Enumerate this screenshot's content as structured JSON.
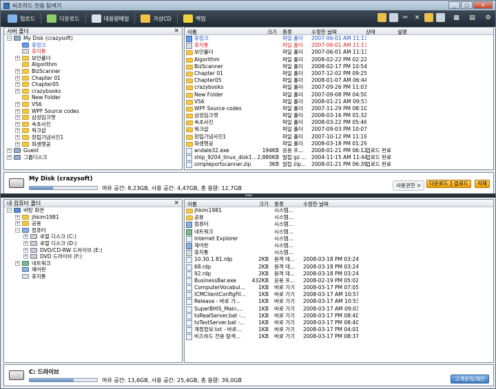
{
  "window": {
    "title": "비즈하드 전용 탐색기"
  },
  "toolbar": {
    "buttons": [
      {
        "label": "업로드",
        "color": "#7fb5ea"
      },
      {
        "label": "다운로드",
        "color": "#8fd06a"
      },
      {
        "label": "대용량메일",
        "color": "#d9e2ea"
      },
      {
        "label": "가상CD",
        "color": "#f3c24a"
      },
      {
        "label": "백업",
        "color": "#f2d23c"
      }
    ],
    "right_icons": [
      "new-folder-icon",
      "copy-icon",
      "cut-icon",
      "delete-icon",
      "paste-icon",
      "properties-icon",
      "view-icon",
      "layout-icon",
      "settings-icon"
    ]
  },
  "server": {
    "title": "서버 폴더",
    "close": "×",
    "tree": [
      {
        "label": "My Disk (crazysoft)",
        "level": 0,
        "toggle": "−",
        "color": "#000",
        "kind": "disk"
      },
      {
        "label": "휴링크",
        "level": 1,
        "toggle": "",
        "color": "#1f4fd1",
        "kind": "special"
      },
      {
        "label": "휴지통",
        "level": 1,
        "toggle": "",
        "color": "#d62020",
        "kind": "trash"
      },
      {
        "label": "보안폴더",
        "level": 1,
        "toggle": "+",
        "color": "#000",
        "kind": "folder"
      },
      {
        "label": "Algorithm",
        "level": 1,
        "toggle": "",
        "color": "#000",
        "kind": "folder"
      },
      {
        "label": "BizScanner",
        "level": 1,
        "toggle": "+",
        "color": "#000",
        "kind": "folder"
      },
      {
        "label": "Chapter 01",
        "level": 1,
        "toggle": "+",
        "color": "#000",
        "kind": "folder"
      },
      {
        "label": "Chapter05",
        "level": 1,
        "toggle": "+",
        "color": "#000",
        "kind": "folder"
      },
      {
        "label": "crazybooks",
        "level": 1,
        "toggle": "+",
        "color": "#000",
        "kind": "folder"
      },
      {
        "label": "New Folder",
        "level": 1,
        "toggle": "",
        "color": "#000",
        "kind": "folder"
      },
      {
        "label": "VS6",
        "level": 1,
        "toggle": "+",
        "color": "#000",
        "kind": "folder"
      },
      {
        "label": "WPF Source codes",
        "level": 1,
        "toggle": "+",
        "color": "#000",
        "kind": "folder"
      },
      {
        "label": "삼성임크젯",
        "level": 1,
        "toggle": "+",
        "color": "#000",
        "kind": "folder"
      },
      {
        "label": "속초사진",
        "level": 1,
        "toggle": "+",
        "color": "#000",
        "kind": "folder"
      },
      {
        "label": "워크샵",
        "level": 1,
        "toggle": "+",
        "color": "#000",
        "kind": "folder"
      },
      {
        "label": "창립기념사진1",
        "level": 1,
        "toggle": "+",
        "color": "#000",
        "kind": "folder"
      },
      {
        "label": "화생행공",
        "level": 1,
        "toggle": "+",
        "color": "#000",
        "kind": "folder"
      },
      {
        "label": "Guest",
        "level": 0,
        "toggle": "+",
        "color": "#000",
        "kind": "disk"
      },
      {
        "label": "그룹디스크",
        "level": 0,
        "toggle": "+",
        "color": "#000",
        "kind": "disk"
      }
    ],
    "columns": [
      "이름",
      "크기",
      "종류",
      "수정한 날짜",
      "상태",
      "설명"
    ],
    "files": [
      {
        "name": "휴링크",
        "size": "",
        "type": "파일 폴더",
        "date": "2007-06-01 AM 11:13",
        "status": "",
        "color": "#1f4fd1",
        "kind": "special"
      },
      {
        "name": "휴지통",
        "size": "",
        "type": "파일 폴더",
        "date": "2007-06-01 AM 11:13",
        "status": "",
        "color": "#d62020",
        "kind": "trash"
      },
      {
        "name": "보안폴더",
        "size": "",
        "type": "파일 폴더",
        "date": "2007-06-01 AM 11:13",
        "status": "",
        "color": "#000",
        "kind": "folder"
      },
      {
        "name": "Algorithm",
        "size": "",
        "type": "파일 폴더",
        "date": "2008-02-22 PM 02:22",
        "status": "",
        "color": "#000",
        "kind": "folder"
      },
      {
        "name": "BizScanner",
        "size": "",
        "type": "파일 폴더",
        "date": "2008-02-17 PM 10:54",
        "status": "",
        "color": "#000",
        "kind": "folder"
      },
      {
        "name": "Chapter 01",
        "size": "",
        "type": "파일 폴더",
        "date": "2007-12-02 PM 09:25",
        "status": "",
        "color": "#000",
        "kind": "folder"
      },
      {
        "name": "Chapter05",
        "size": "",
        "type": "파일 폴더",
        "date": "2008-01-07 AM 06:44",
        "status": "",
        "color": "#000",
        "kind": "folder"
      },
      {
        "name": "crazybooks",
        "size": "",
        "type": "파일 폴더",
        "date": "2007-09-26 PM 11:03",
        "status": "",
        "color": "#000",
        "kind": "folder"
      },
      {
        "name": "New Folder",
        "size": "",
        "type": "파일 폴더",
        "date": "2007-09-08 PM 04:50",
        "status": "",
        "color": "#000",
        "kind": "folder"
      },
      {
        "name": "VS6",
        "size": "",
        "type": "파일 폴더",
        "date": "2008-01-21 AM 09:57",
        "status": "",
        "color": "#000",
        "kind": "folder"
      },
      {
        "name": "WPF Source codes",
        "size": "",
        "type": "파일 폴더",
        "date": "2007-11-29 PM 08:10",
        "status": "",
        "color": "#000",
        "kind": "folder"
      },
      {
        "name": "삼성임크젯",
        "size": "",
        "type": "파일 폴더",
        "date": "2008-03-16 PM 01:32",
        "status": "",
        "color": "#000",
        "kind": "folder"
      },
      {
        "name": "속초사진",
        "size": "",
        "type": "파일 폴더",
        "date": "2008-03-22 PM 05:46",
        "status": "",
        "color": "#000",
        "kind": "folder"
      },
      {
        "name": "워크샵",
        "size": "",
        "type": "파일 폴더",
        "date": "2007-09-03 PM 10:07",
        "status": "",
        "color": "#000",
        "kind": "folder"
      },
      {
        "name": "창립기념사진1",
        "size": "",
        "type": "파일 폴더",
        "date": "2007-10-12 PM 11:19",
        "status": "",
        "color": "#000",
        "kind": "folder"
      },
      {
        "name": "화생행공",
        "size": "",
        "type": "파일 폴더",
        "date": "2008-03-18 PM 01:29",
        "status": "",
        "color": "#000",
        "kind": "folder"
      },
      {
        "name": "andale32.exe",
        "size": "194KB",
        "type": "응용 프...",
        "date": "2008-01-21 PM 06:12",
        "status": "업로드 완료",
        "color": "#000",
        "kind": "file"
      },
      {
        "name": "ship_9204_linux_disk1...",
        "size": "2,880KB",
        "type": "알집 gz ...",
        "date": "2004-11-15 AM 11:44",
        "status": "업로드 완료",
        "color": "#000",
        "kind": "file"
      },
      {
        "name": "simpleportscanner.zip",
        "size": "3KB",
        "type": "알집 zip...",
        "date": "2008-01-21 PM 06:39",
        "status": "업로드 완료",
        "color": "#000",
        "kind": "file"
      }
    ],
    "status": {
      "drive_name": "My Disk (crazysoft)",
      "space_text": "여유 공간: 8,23GB,  사용 공간: 4,47GB,  총 용량: 12,7GB",
      "used_fraction": 0.35,
      "auth_label": "사용권한 >",
      "btn_download": "다운로드",
      "btn_upload": "업로드",
      "btn_delete": "삭제"
    }
  },
  "local": {
    "title": "내 컴퓨터 폴더",
    "close": "×",
    "tree": [
      {
        "label": "바탕 화면",
        "level": 0,
        "toggle": "−",
        "kind": "desktop"
      },
      {
        "label": "jhkim1981",
        "level": 1,
        "toggle": "+",
        "kind": "folder"
      },
      {
        "label": "공용",
        "level": 1,
        "toggle": "+",
        "kind": "folder"
      },
      {
        "label": "컴퓨터",
        "level": 1,
        "toggle": "−",
        "kind": "pc"
      },
      {
        "label": "로컬 디스크 (C:)",
        "level": 2,
        "toggle": "+",
        "kind": "drive"
      },
      {
        "label": "로컬 디스크 (D:)",
        "level": 2,
        "toggle": "+",
        "kind": "drive"
      },
      {
        "label": "DVD/CD-RW 드라이브 (E:)",
        "level": 2,
        "toggle": "+",
        "kind": "drive"
      },
      {
        "label": "DVD 드라이브 (F:)",
        "level": 2,
        "toggle": "+",
        "kind": "drive"
      },
      {
        "label": "네트워크",
        "level": 1,
        "toggle": "+",
        "kind": "net"
      },
      {
        "label": "제어판",
        "level": 1,
        "toggle": "",
        "kind": "pc"
      },
      {
        "label": "휴지통",
        "level": 1,
        "toggle": "",
        "kind": "trash"
      }
    ],
    "columns": [
      "이름",
      "크기",
      "종류",
      "수정한 날짜"
    ],
    "files": [
      {
        "name": "jhkim1981",
        "size": "",
        "type": "시스템...",
        "date": "",
        "kind": "folder"
      },
      {
        "name": "공용",
        "size": "",
        "type": "시스템...",
        "date": "",
        "kind": "folder"
      },
      {
        "name": "컴퓨터",
        "size": "",
        "type": "시스템...",
        "date": "",
        "kind": "pc"
      },
      {
        "name": "네트워크",
        "size": "",
        "type": "시스템...",
        "date": "",
        "kind": "net"
      },
      {
        "name": "Internet Explorer",
        "size": "",
        "type": "시스템...",
        "date": "",
        "kind": "file"
      },
      {
        "name": "제어판",
        "size": "",
        "type": "시스템...",
        "date": "",
        "kind": "pc"
      },
      {
        "name": "휴지통",
        "size": "",
        "type": "시스템...",
        "date": "",
        "kind": "trash"
      },
      {
        "name": "10.30.1.81.rdp",
        "size": "2KB",
        "type": "원격 데...",
        "date": "2008-03-18 PM 03:24",
        "kind": "file"
      },
      {
        "name": "68.rdp",
        "size": "2KB",
        "type": "원격 데...",
        "date": "2008-03-18 PM 03:24",
        "kind": "file"
      },
      {
        "name": "92.rdp",
        "size": "2KB",
        "type": "원격 데...",
        "date": "2008-03-18 PM 03:24",
        "kind": "file"
      },
      {
        "name": "BusinessBar.exe",
        "size": "432KB",
        "type": "응용 프...",
        "date": "2008-02-19 PM 05:02",
        "kind": "file"
      },
      {
        "name": "ComputerVocabul...",
        "size": "1KB",
        "type": "바로 가기",
        "date": "2008-03-17 PM 07:05",
        "kind": "file"
      },
      {
        "name": "ICMClientConfigFil...",
        "size": "1KB",
        "type": "바로 가기",
        "date": "2008-03-17 AM 10:57",
        "kind": "file"
      },
      {
        "name": "Release - 바로 가...",
        "size": "1KB",
        "type": "바로 가기",
        "date": "2008-03-17 AM 10:53",
        "kind": "file"
      },
      {
        "name": "SuperBHIS_Main....",
        "size": "1KB",
        "type": "바로 가기",
        "date": "2008-03-17 AM 09:03",
        "kind": "file"
      },
      {
        "name": "toRealServer.bat -...",
        "size": "1KB",
        "type": "바로 가기",
        "date": "2008-03-17 PM 08:40",
        "kind": "file"
      },
      {
        "name": "toTestServer.bat -...",
        "size": "1KB",
        "type": "바로 가기",
        "date": "2008-03-17 PM 08:40",
        "kind": "file"
      },
      {
        "name": "계정정보.txt - 바로...",
        "size": "1KB",
        "type": "바로 가기",
        "date": "2008-03-17 PM 04:01",
        "kind": "file"
      },
      {
        "name": "비즈하드 전용 탐색...",
        "size": "1KB",
        "type": "바로 가기",
        "date": "2008-03-17 PM 08:37",
        "kind": "file"
      }
    ],
    "status": {
      "drive_name": "C: 드라이브",
      "space_text": "여유 공간: 13,6GB,  사용 공간: 25,4GB,  총 용량: 39,0GB",
      "used_fraction": 0.65,
      "feedback": "고객문의/제안"
    }
  }
}
